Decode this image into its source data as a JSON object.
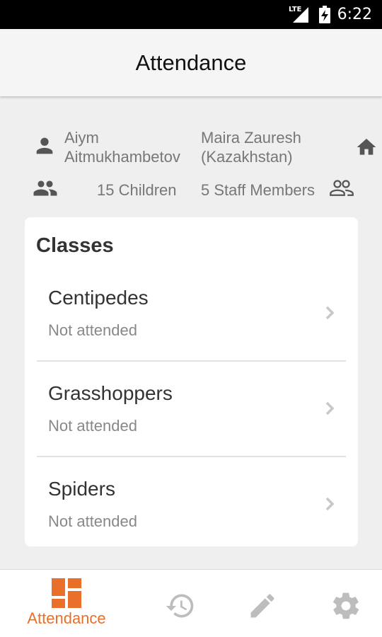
{
  "status_bar": {
    "time": "6:22",
    "network": "LTE"
  },
  "app_bar": {
    "title": "Attendance"
  },
  "info": {
    "user_name": "Aiym\nAitmukhambetov",
    "location": "Maira Zauresh\n(Kazakhstan)",
    "children": "15 Children",
    "staff": "5 Staff Members"
  },
  "classes": {
    "title": "Classes",
    "items": [
      {
        "name": "Centipedes",
        "status": "Not attended"
      },
      {
        "name": "Grasshoppers",
        "status": "Not attended"
      },
      {
        "name": "Spiders",
        "status": "Not attended"
      }
    ]
  },
  "bottom_nav": {
    "items": [
      {
        "label": "Attendance",
        "icon": "dashboard-icon",
        "active": true
      },
      {
        "label": "",
        "icon": "history-icon",
        "active": false
      },
      {
        "label": "",
        "icon": "edit-icon",
        "active": false
      },
      {
        "label": "",
        "icon": "settings-icon",
        "active": false
      }
    ]
  },
  "colors": {
    "accent": "#e8702a",
    "inactive_icon": "#bdbdbd",
    "background": "#efefef"
  }
}
